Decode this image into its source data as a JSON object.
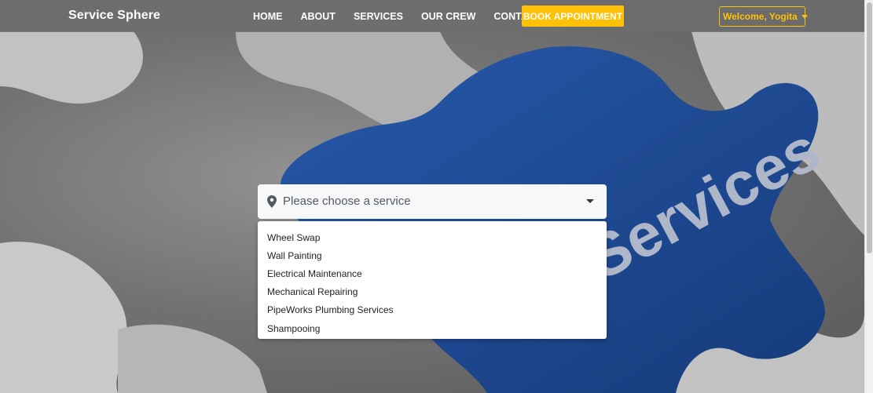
{
  "navbar": {
    "brand": "Service Sphere",
    "links": [
      "HOME",
      "ABOUT",
      "SERVICES",
      "OUR CREW",
      "CONTACT"
    ],
    "book_label": "BOOK APPOINTMENT",
    "user_label": "Welcome, Yogita"
  },
  "hero": {
    "puzzle_text": "Services"
  },
  "service_select": {
    "placeholder": "Please choose a service",
    "options": [
      "Wheel Swap",
      "Wall Painting",
      "Electrical Maintenance",
      "Mechanical Repairing",
      "PipeWorks Plumbing Services",
      "Shampooing"
    ]
  },
  "colors": {
    "accent": "#ffc107",
    "puzzle_blue": "#1f4f9e",
    "navbar_bg": "#6e6e6e"
  }
}
